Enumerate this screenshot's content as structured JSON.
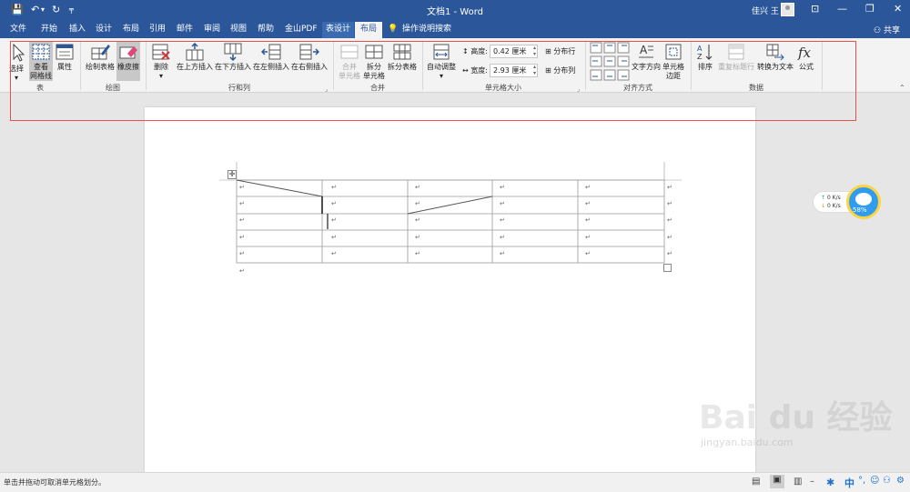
{
  "titlebar": {
    "save": "💾",
    "undo": "↶",
    "undo_dropdown": "▾",
    "redo": "↻",
    "customize": "╤",
    "document_title": "文档1 - Word",
    "user_name": "佳兴 王",
    "ribbon_display": "⊡",
    "minimize": "—",
    "restore": "❐",
    "close": "✕"
  },
  "tabs": {
    "items": [
      "文件",
      "开始",
      "插入",
      "设计",
      "布局",
      "引用",
      "邮件",
      "审阅",
      "视图",
      "帮助",
      "金山PDF",
      "表设计",
      "布局"
    ],
    "active_index": 12,
    "search": "操作说明搜索",
    "share": "共享"
  },
  "ribbon": {
    "groups": {
      "table": "表",
      "draw": "绘图",
      "rows_cols": "行和列",
      "merge": "合并",
      "cell_size": "单元格大小",
      "alignment": "对齐方式",
      "data": "数据"
    },
    "table": {
      "select": "选择",
      "view_gridlines": "查看\n网格线",
      "properties": "属性"
    },
    "draw": {
      "draw_table": "绘制表格",
      "eraser": "橡皮擦"
    },
    "rows_cols": {
      "delete": "删除",
      "insert_above": "在上方插入",
      "insert_below": "在下方插入",
      "insert_left": "在左侧插入",
      "insert_right": "在右侧插入"
    },
    "merge": {
      "merge_cells": "合并\n单元格",
      "split_cells": "拆分\n单元格",
      "split_table": "拆分表格"
    },
    "cell_size": {
      "autofit": "自动调整",
      "height_label": "高度:",
      "height_value": "0.42 厘米",
      "width_label": "宽度:",
      "width_value": "2.93 厘米",
      "distribute_rows": "分布行",
      "distribute_cols": "分布列"
    },
    "alignment": {
      "text_direction": "文字方向",
      "cell_margins": "单元格\n边距"
    },
    "data": {
      "sort": "排序",
      "repeat_header": "重复标题行",
      "convert_to_text": "转换为文本",
      "formula": "公式"
    }
  },
  "document": {
    "cell_mark": "↵",
    "table_rows": 5,
    "table_cols": 5
  },
  "widget": {
    "upload": "0 K/s",
    "download": "0 K/s",
    "percent": "58%"
  },
  "statusbar": {
    "message": "单击并拖动可取消单元格划分。",
    "ime": "中"
  },
  "watermark": {
    "brand": "Bai du 经验",
    "url": "jingyan.baidu.com"
  },
  "colors": {
    "title_bar": "#2b579a",
    "ribbon": "#f3f3f3",
    "highlight_box": "#e5514c"
  }
}
